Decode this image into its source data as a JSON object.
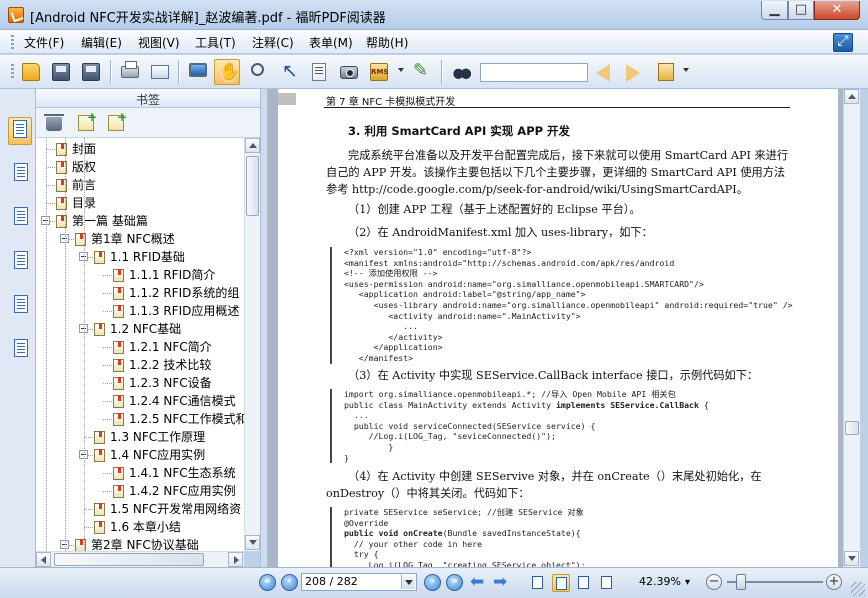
{
  "window": {
    "title": "[Android NFC开发实战详解]_赵波编著.pdf - 福昕PDF阅读器",
    "minimize_glyph": "▁",
    "maximize_glyph": "□",
    "close_glyph": "✕"
  },
  "menu": {
    "items": [
      {
        "label": "文件(F)"
      },
      {
        "label": "编辑(E)"
      },
      {
        "label": "视图(V)"
      },
      {
        "label": "工具(T)"
      },
      {
        "label": "注释(C)"
      },
      {
        "label": "表单(M)"
      },
      {
        "label": "帮助(H)"
      }
    ]
  },
  "toolbar": {
    "search_value": "",
    "rms_label": "RMS"
  },
  "sidebar": {
    "header": "书签",
    "tree": [
      {
        "label": "封面",
        "level": 0,
        "expander": false
      },
      {
        "label": "版权",
        "level": 0,
        "expander": false
      },
      {
        "label": "前言",
        "level": 0,
        "expander": false
      },
      {
        "label": "目录",
        "level": 0,
        "expander": false
      },
      {
        "label": "第一篇 基础篇",
        "level": 0,
        "expander": true
      },
      {
        "label": "第1章 NFC概述",
        "level": 1,
        "expander": true
      },
      {
        "label": "1.1 RFID基础",
        "level": 2,
        "expander": true
      },
      {
        "label": "1.1.1 RFID简介",
        "level": 3,
        "expander": false
      },
      {
        "label": "1.1.2 RFID系统的组",
        "level": 3,
        "expander": false
      },
      {
        "label": "1.1.3 RFID应用概述",
        "level": 3,
        "expander": false
      },
      {
        "label": "1.2 NFC基础",
        "level": 2,
        "expander": true
      },
      {
        "label": "1.2.1 NFC简介",
        "level": 3,
        "expander": false
      },
      {
        "label": "1.2.2 技术比较",
        "level": 3,
        "expander": false
      },
      {
        "label": "1.2.3 NFC设备",
        "level": 3,
        "expander": false
      },
      {
        "label": "1.2.4 NFC通信模式",
        "level": 3,
        "expander": false
      },
      {
        "label": "1.2.5 NFC工作模式和",
        "level": 3,
        "expander": false
      },
      {
        "label": "1.3 NFC工作原理",
        "level": 2,
        "expander": false
      },
      {
        "label": "1.4 NFC应用实例",
        "level": 2,
        "expander": true
      },
      {
        "label": "1.4.1 NFC生态系统",
        "level": 3,
        "expander": false
      },
      {
        "label": "1.4.2 NFC应用实例",
        "level": 3,
        "expander": false
      },
      {
        "label": "1.5 NFC开发常用网络资",
        "level": 2,
        "expander": false
      },
      {
        "label": "1.6 本章小结",
        "level": 2,
        "expander": false
      },
      {
        "label": "第2章 NFC协议基础",
        "level": 1,
        "expander": true
      }
    ]
  },
  "document": {
    "header": "第 7 章   NFC 卡模拟模式开发",
    "section_title": "3.  利用 SmartCard API 实现 APP 开发",
    "para1": "完成系统平台准备以及开发平台配置完成后，接下来就可以使用 SmartCard API 来进行自己的 APP 开发。该操作主要包括以下几个主要步骤，更详细的 SmartCard API 使用方法参考 http://code.google.com/p/seek-for-android/wiki/UsingSmartCardAPI。",
    "step1": "（1）创建 APP 工程（基于上述配置好的 Eclipse 平台）。",
    "step2": "（2）在 AndroidManifest.xml 加入 uses-library，如下：",
    "code1": "<?xml version=\"1.0\" encoding=\"utf-8\"?>\n<manifest xmlns:android=\"http://schemas.android.com/apk/res/android\n<!-- 添加使用权限 -->\n<uses-permission android:name=\"org.simalliance.openmobileapi.SMARTCARD\"/>\n   <application android:label=\"@string/app_name\">\n      <uses-library android:name=\"org.simalliance.openmobileapi\" android:required=\"true\" />\n         <activity android:name=\".MainActivity\">\n            ...\n         </activity>\n      </application>\n   </manifest>",
    "step3": "（3）在 Activity 中实现 SEService.CallBack interface 接口，示例代码如下：",
    "code2_l1": "import org.simalliance.openmobileapi.*; //导入 Open Mobile API 相关包",
    "code2_l2a": "public class MainActivity extends Activity ",
    "code2_l2b": "implements SEService.CallBack",
    "code2_l2c": " {",
    "code2_rest": "  ...\n  public void serviceConnected(SEService service) {\n     //Log.i(LOG_Tag, \"seviceConnected()\");\n         }\n}",
    "step4": "（4）在 Activity 中创建 SEServive 对象，并在 onCreate（）末尾处初始化，在 onDestroy（）中将其关闭。代码如下：",
    "code3_l1": "private SEService seService; //创建 SEService 对象",
    "code3_l2": "@Override",
    "code3_l3a": "public void onCreate",
    "code3_l3b": "(Bundle savedInstanceState){",
    "code3_rest": "  // your other code in here\n  try {\n     Log.i(LOG_Tag, \"creating SEService object\");"
  },
  "statusbar": {
    "page_display": "208 / 282",
    "zoom_display": "42.39%",
    "zoom_out_glyph": "−",
    "zoom_in_glyph": "+"
  }
}
